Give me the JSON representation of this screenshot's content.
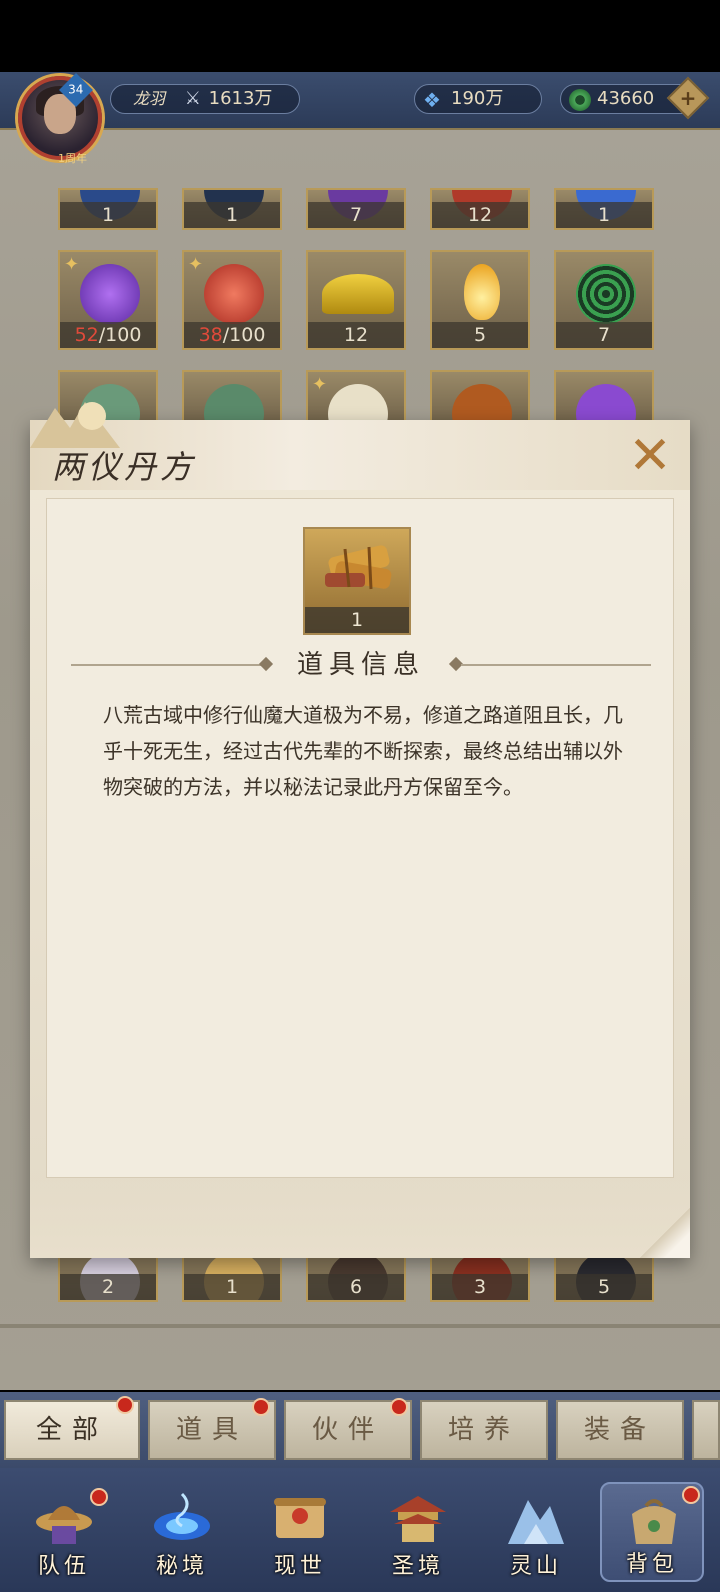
{
  "header": {
    "avatar_level": "34",
    "avatar_tag": "1周年",
    "player_name": "龙羽",
    "power": "1613万",
    "gems": "190万",
    "jade": "43660"
  },
  "inventory": {
    "row1": [
      {
        "count": "1",
        "color": "#2a4a8a"
      },
      {
        "count": "1",
        "color": "#22324e"
      },
      {
        "count": "7",
        "color": "#6a3aa0"
      },
      {
        "count": "12",
        "color": "#b03a2a"
      },
      {
        "count": "1",
        "color": "#3a6ad0"
      }
    ],
    "row2": [
      {
        "have": "52",
        "need": "/100",
        "color": "#7a3ad0"
      },
      {
        "have": "38",
        "need": "/100",
        "color": "#c83a2a"
      },
      {
        "count": "12",
        "color": "#d0a020"
      },
      {
        "count": "5",
        "color": "#e8a020"
      },
      {
        "count": "7",
        "color": "#1f6a3a"
      }
    ],
    "row4": [
      {
        "count": "2",
        "color": "#d8d0e0"
      },
      {
        "count": "1",
        "color": "#d8b060"
      },
      {
        "count": "6",
        "color": "#4a3a30"
      },
      {
        "count": "3",
        "color": "#8a3020"
      },
      {
        "count": "5",
        "color": "#2a2a30"
      }
    ]
  },
  "dialog": {
    "title": "两仪丹方",
    "item_count": "1",
    "section_title": "道具信息",
    "description": "八荒古域中修行仙魔大道极为不易，修道之路道阻且长，几乎十死无生，经过古代先辈的不断探索，最终总结出辅以外物突破的方法，并以秘法记录此丹方保留至今。"
  },
  "tabs": [
    "全部",
    "道具",
    "伙伴",
    "培养",
    "装备"
  ],
  "nav": [
    "队伍",
    "秘境",
    "现世",
    "圣境",
    "灵山",
    "背包"
  ]
}
